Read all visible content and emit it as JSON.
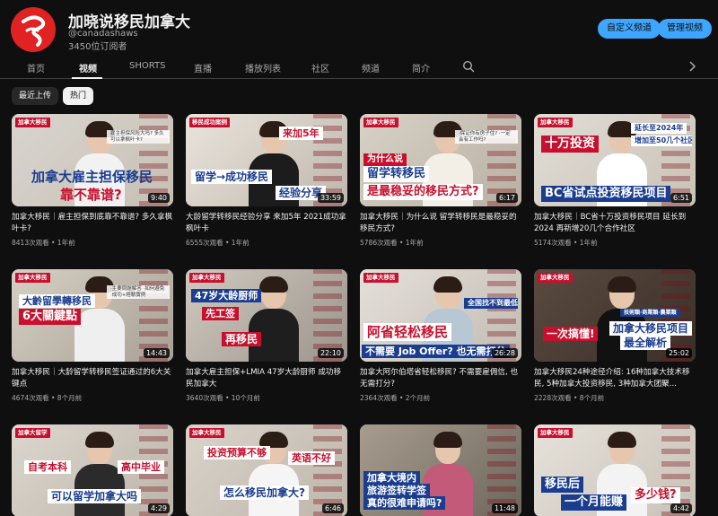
{
  "channel": {
    "name": "加晓说移民加拿大",
    "handle": "@canadashaws",
    "subscribers": "3450位订阅者",
    "customize_label": "自定义频道",
    "manage_label": "管理视频"
  },
  "tabs": [
    "首页",
    "视频",
    "SHORTS",
    "直播",
    "播放列表",
    "社区",
    "频道",
    "简介"
  ],
  "active_tab": "视频",
  "filters": [
    "最近上传",
    "热门"
  ],
  "active_filter": "热门",
  "colors": {
    "accent": "#3ea6ff",
    "brand_red": "#c8102e",
    "background": "#0f0f0f"
  },
  "videos": [
    {
      "badge": "加拿大移民",
      "captions": [
        "加拿大雇主担保移民",
        "靠不靠谱?"
      ],
      "small_text": "雇主担保风险大吗? 多久可以拿枫叶卡?",
      "duration": "9:40",
      "title": "加拿大移民｜雇主担保到底靠不靠谱? 多久拿枫叶卡?",
      "views": "8413次观看",
      "age": "1年前"
    },
    {
      "badge": "移民成功案例",
      "captions": [
        "来加5年",
        "留学→成功移民",
        "经验分享"
      ],
      "small_text": "",
      "duration": "33:59",
      "title": "大龄留学转移民经验分享 来加5年 2021成功拿枫叶卡",
      "views": "6555次观看",
      "age": "1年前"
    },
    {
      "badge": "加拿大移民",
      "captions": [
        "为什么说",
        "留学转移民",
        "是最稳妥的移民方式?"
      ],
      "small_text": "·保证你有房子住? ·一定会有工作吗?",
      "duration": "6:17",
      "title": "加拿大移民｜为什么说 留学转移民是最稳妥的移民方式?",
      "views": "5786次观看",
      "age": "1年前"
    },
    {
      "badge": "加拿大移民",
      "captions": [
        "十万投资",
        "延长至2024年",
        "增加至50几个社区",
        "BC省试点投资移民项目"
      ],
      "small_text": "",
      "duration": "6:51",
      "title": "加拿大移民｜BC省十万投资移民项目 延长到2024 再新增20几个合作社区",
      "views": "5174次观看",
      "age": "1年前"
    },
    {
      "badge": "加拿大移民",
      "captions": [
        "大齡留學轉移民",
        "6大關鍵點"
      ],
      "small_text": "·主要問題解答 ·如何避免 ·成功+經驗實例",
      "duration": "14:43",
      "title": "加拿大移民｜大龄留学转移民签证通过的6大关键点",
      "views": "4674次观看",
      "age": "8个月前"
    },
    {
      "badge": "加拿大移民",
      "captions": [
        "47岁大龄厨师",
        "先工签",
        "再移民"
      ],
      "small_text": "",
      "duration": "22:10",
      "title": "加拿大雇主担保+LMIA 47岁大龄厨师 成功移民加拿大",
      "views": "3640次观看",
      "age": "10个月前"
    },
    {
      "badge": "加拿大移民",
      "captions": [
        "全国找不到最低!",
        "阿省轻松移民",
        "不需要 Job Offer? 也无需打分"
      ],
      "small_text": "",
      "duration": "26:28",
      "title": "加拿大阿尔伯塔省轻松移民? 不需要雇佣信, 也无需打分?",
      "views": "2364次观看",
      "age": "2个月前"
    },
    {
      "badge": "加拿大移民",
      "captions": [
        "技術類·商業類·農業類",
        "一次搞懂!",
        "加拿大移民项目",
        "最全解析"
      ],
      "small_text": "",
      "duration": "25:02",
      "title": "加拿大移民24种途径介绍: 16种加拿大技术移民, 5种加拿大投资移民, 3种加拿大团聚...",
      "views": "2228次观看",
      "age": "8个月前"
    },
    {
      "badge": "加拿大留学",
      "captions": [
        "自考本科",
        "高中毕业",
        "可以留学加拿大吗"
      ],
      "small_text": "",
      "duration": "4:29",
      "title": "",
      "views": "",
      "age": ""
    },
    {
      "badge": "加拿大移民",
      "captions": [
        "投资预算不够",
        "英语不好",
        "怎么移民加拿大?"
      ],
      "small_text": "",
      "duration": "6:46",
      "title": "",
      "views": "",
      "age": ""
    },
    {
      "badge": "",
      "captions": [
        "加拿大境内",
        "旅游签转学签",
        "真的很难申请吗?"
      ],
      "small_text": "",
      "duration": "11:48",
      "title": "",
      "views": "",
      "age": ""
    },
    {
      "badge": "加拿大移民",
      "captions": [
        "移民后",
        "一个月能赚",
        "多少钱?"
      ],
      "small_text": "",
      "duration": "4:42",
      "title": "",
      "views": "",
      "age": ""
    }
  ]
}
